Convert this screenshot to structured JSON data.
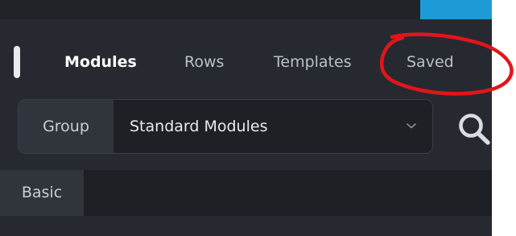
{
  "tabs": {
    "modules": "Modules",
    "rows": "Rows",
    "templates": "Templates",
    "saved": "Saved",
    "active": "Modules"
  },
  "group": {
    "label": "Group",
    "selected": "Standard Modules"
  },
  "category": {
    "active": "Basic"
  },
  "icons": {
    "search": "search-icon",
    "dropdown": "chevron-down-icon"
  },
  "colors": {
    "panel_background": "#262a30",
    "accent": "#1e9bd7",
    "annotation": "#e3151a"
  }
}
